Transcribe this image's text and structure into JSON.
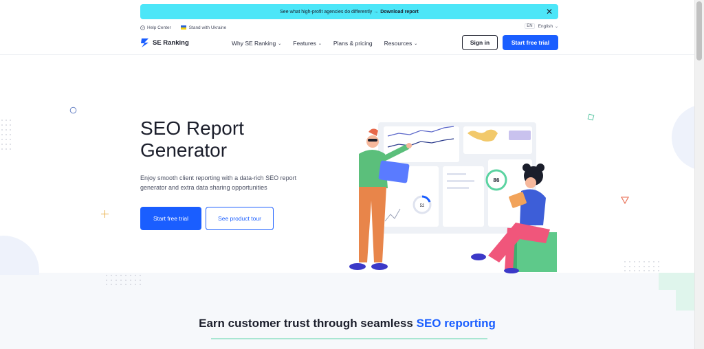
{
  "promo": {
    "text": "See what high-profit agencies do differently →",
    "link": "Download report"
  },
  "util": {
    "help": "Help Center",
    "ukraine": "Stand with Ukraine",
    "lang_code": "EN",
    "lang_name": "English"
  },
  "nav": {
    "logo": "SE Ranking",
    "items": [
      {
        "label": "Why SE Ranking",
        "dropdown": true
      },
      {
        "label": "Features",
        "dropdown": true
      },
      {
        "label": "Plans & pricing",
        "dropdown": false
      },
      {
        "label": "Resources",
        "dropdown": true
      }
    ],
    "signin": "Sign in",
    "trial": "Start free trial"
  },
  "hero": {
    "title": "SEO Report Generator",
    "subtitle": "Enjoy smooth client reporting with a data-rich SEO report generator and extra data sharing opportunities",
    "primary_button": "Start free trial",
    "secondary_button": "See product tour",
    "score_value": "86",
    "small_score": "52"
  },
  "section": {
    "title_plain": "Earn customer trust through seamless",
    "title_highlight": "SEO reporting"
  },
  "colors": {
    "accent": "#1a5eff",
    "promo_bg": "#4ce6f8",
    "underline": "#a8e6d2"
  }
}
